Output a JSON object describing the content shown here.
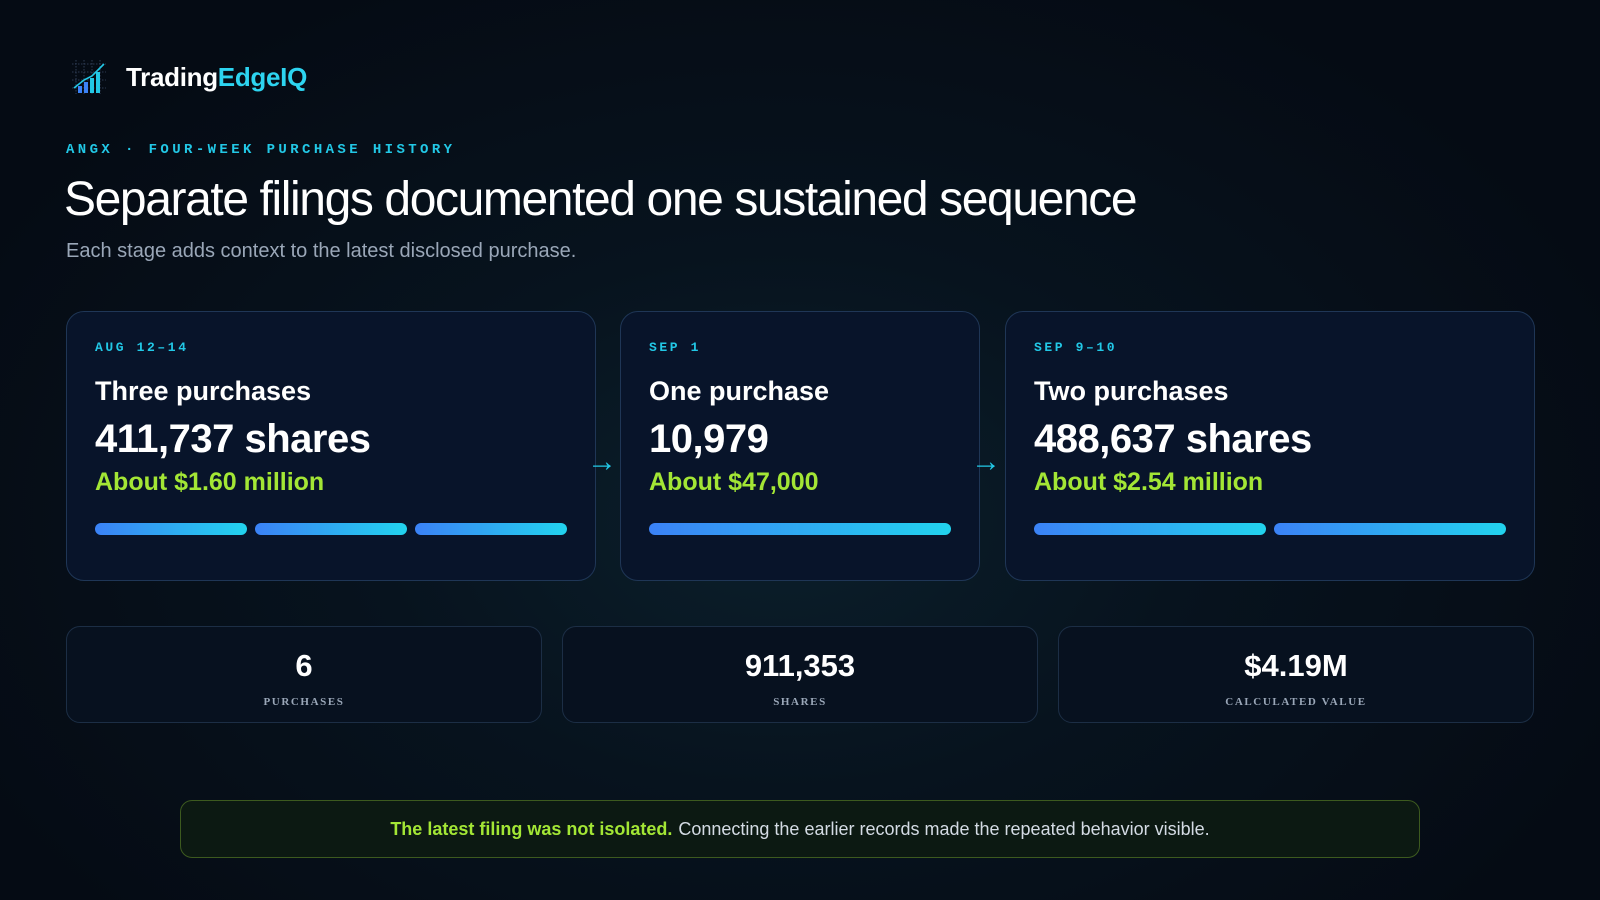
{
  "brand": {
    "name_part1": "Trading",
    "name_part2": "EdgeIQ",
    "logo_icon": "bar-chart-grid-icon"
  },
  "header": {
    "eyebrow": "ANGX · FOUR-WEEK PURCHASE HISTORY",
    "title": "Separate filings documented one sustained sequence",
    "subtitle": "Each stage adds context to the latest disclosed purchase."
  },
  "stages": [
    {
      "date": "AUG 12–14",
      "title": "Three purchases",
      "shares": "411,737 shares",
      "value": "About $1.60 million",
      "purchase_count": 3
    },
    {
      "date": "SEP 1",
      "title": "One purchase",
      "shares": "10,979",
      "value": "About $47,000",
      "purchase_count": 1
    },
    {
      "date": "SEP 9–10",
      "title": "Two purchases",
      "shares": "488,637 shares",
      "value": "About $2.54 million",
      "purchase_count": 2
    }
  ],
  "arrows": [
    "→",
    "→"
  ],
  "stats": [
    {
      "value": "6",
      "label": "PURCHASES"
    },
    {
      "value": "911,353",
      "label": "SHARES"
    },
    {
      "value": "$4.19M",
      "label": "CALCULATED VALUE"
    }
  ],
  "callout": {
    "emphasis": "The latest filing was not isolated.",
    "text": "Connecting the earlier records made the repeated behavior visible."
  },
  "colors": {
    "accent_cyan": "#22c8e6",
    "accent_green": "#a3e635",
    "bar_start": "#3b82f6",
    "bar_end": "#22d3ee"
  }
}
